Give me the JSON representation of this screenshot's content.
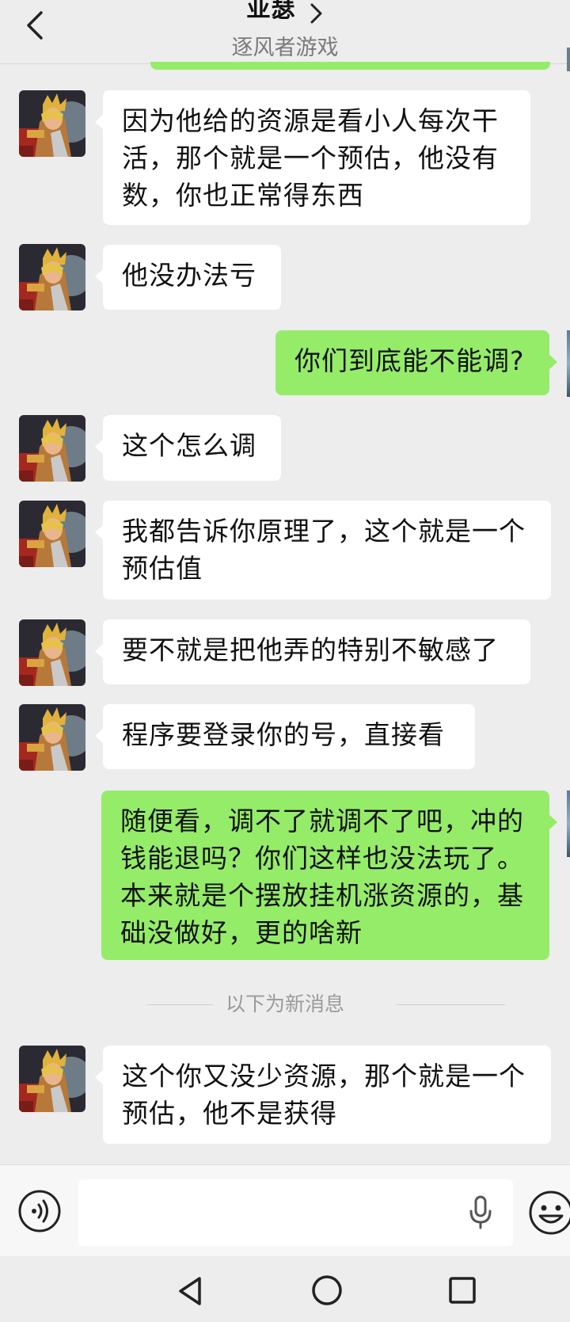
{
  "header": {
    "title": "亚瑟",
    "subtitle": "逐风者游戏"
  },
  "messages": [
    {
      "side": "in",
      "text": "因为他给的资源是看小人每次干活，那个就是一个预估，他没有数，你也正常得东西"
    },
    {
      "side": "in",
      "text": "他没办法亏"
    },
    {
      "side": "out",
      "text": "你们到底能不能调?"
    },
    {
      "side": "in",
      "text": "这个怎么调"
    },
    {
      "side": "in",
      "text": "我都告诉你原理了，这个就是一个预估值"
    },
    {
      "side": "in",
      "text": "要不就是把他弄的特别不敏感了"
    },
    {
      "side": "in",
      "text": "程序要登录你的号，直接看"
    },
    {
      "side": "out",
      "text": "随便看，调不了就调不了吧，冲的钱能退吗？你们这样也没法玩了。本来就是个摆放挂机涨资源的，基础没做好，更的啥新"
    },
    {
      "side": "in",
      "text": "这个你又没少资源，那个就是一个预估，他不是获得"
    }
  ],
  "divider": {
    "label": "以下为新消息"
  },
  "input": {
    "value": ""
  },
  "icons": {
    "back": "chevron-left-icon",
    "title_chevron": "chevron-right-icon",
    "voice": "voice-icon",
    "mic": "mic-icon",
    "emoji": "emoji-icon",
    "nav_back": "triangle-back-icon",
    "nav_home": "circle-home-icon",
    "nav_recent": "square-recent-icon"
  },
  "colors": {
    "background": "#ededed",
    "incoming_bubble": "#ffffff",
    "outgoing_bubble": "#95ec69"
  }
}
